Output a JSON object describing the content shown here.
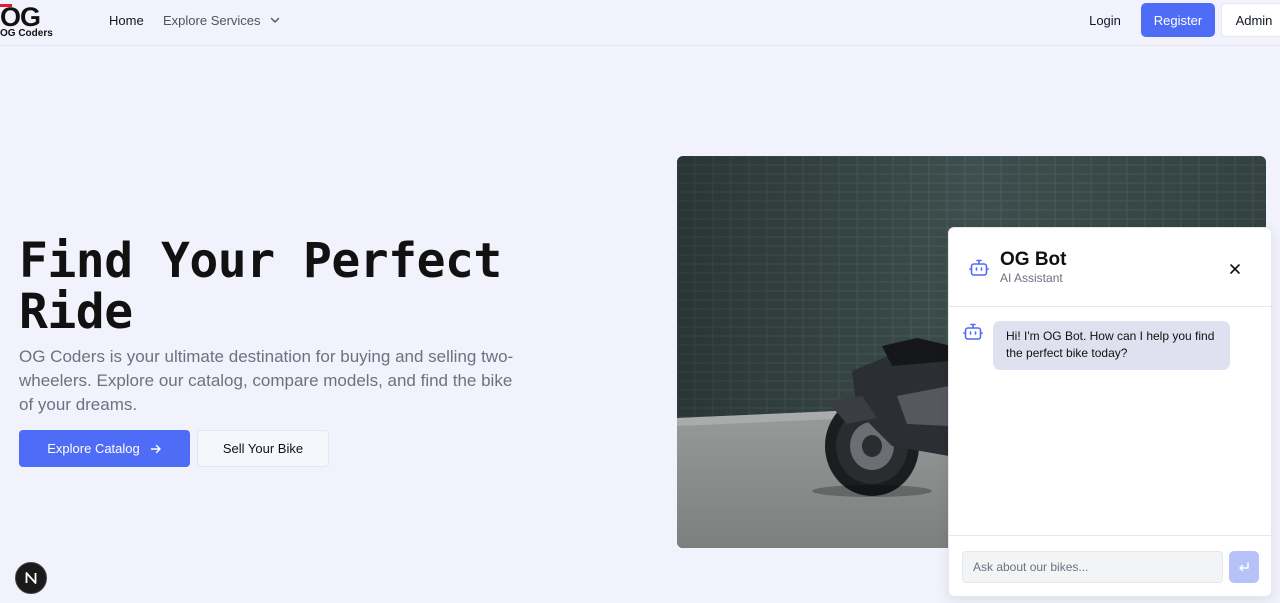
{
  "brand": {
    "mark": "OG",
    "name": "OG Coders",
    "accent": "#e11d2b"
  },
  "nav": {
    "home": "Home",
    "explore_services": "Explore Services",
    "login": "Login",
    "register": "Register",
    "admin": "Admin"
  },
  "hero": {
    "title": "Find Your Perfect Ride",
    "description": "OG Coders is your ultimate destination for buying and selling two-wheelers. Explore our catalog, compare models, and find the bike of your dreams.",
    "primary_cta": "Explore Catalog",
    "secondary_cta": "Sell Your Bike"
  },
  "chat": {
    "title": "OG Bot",
    "subtitle": "AI Assistant",
    "messages": [
      {
        "from": "bot",
        "text": "Hi! I'm OG Bot. How can I help you find the perfect bike today?"
      }
    ],
    "input_placeholder": "Ask about our bikes..."
  },
  "dev_badge": {
    "label": "N"
  },
  "colors": {
    "primary": "#4f6cf7",
    "background": "#f1f2fb",
    "send_disabled": "#b7c2f9"
  }
}
